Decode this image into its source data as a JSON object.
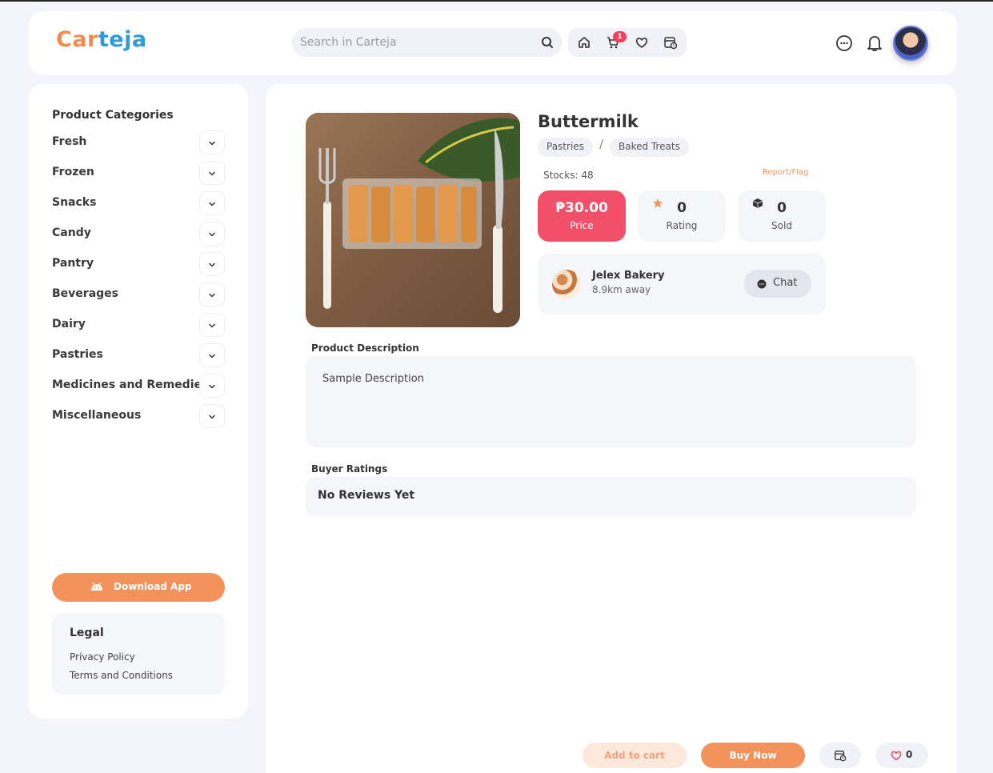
{
  "header": {
    "logo_part1": "Car",
    "logo_part2": "teja",
    "search_placeholder": "Search in Carteja",
    "cart_badge": "1"
  },
  "sidebar": {
    "title": "Product Categories",
    "categories": [
      "Fresh",
      "Frozen",
      "Snacks",
      "Candy",
      "Pantry",
      "Beverages",
      "Dairy",
      "Pastries",
      "Medicines and Remedies",
      "Miscellaneous"
    ],
    "download_label": "Download App",
    "legal": {
      "title": "Legal",
      "privacy": "Privacy Policy",
      "terms": "Terms and Conditions"
    }
  },
  "product": {
    "name": "Buttermilk",
    "tags": [
      "Pastries",
      "Baked Treats"
    ],
    "tag_separator": "/",
    "stocks": "Stocks: 48",
    "report": "Report/Flag",
    "price": "₱30.00",
    "price_label": "Price",
    "rating": "0",
    "rating_label": "Rating",
    "sold": "0",
    "sold_label": "Sold"
  },
  "seller": {
    "name": "Jelex Bakery",
    "distance": "8.9km away",
    "chat_label": "Chat"
  },
  "description": {
    "title": "Product Description",
    "text": "Sample Description"
  },
  "ratings": {
    "title": "Buyer Ratings",
    "empty_text": "No Reviews Yet"
  },
  "actions": {
    "add_to_cart": "Add to cart",
    "buy_now": "Buy Now",
    "favorites_count": "0"
  },
  "colors": {
    "accent": "#f3925b",
    "price": "#f2506a",
    "brand_blue": "#2f9ad9"
  }
}
